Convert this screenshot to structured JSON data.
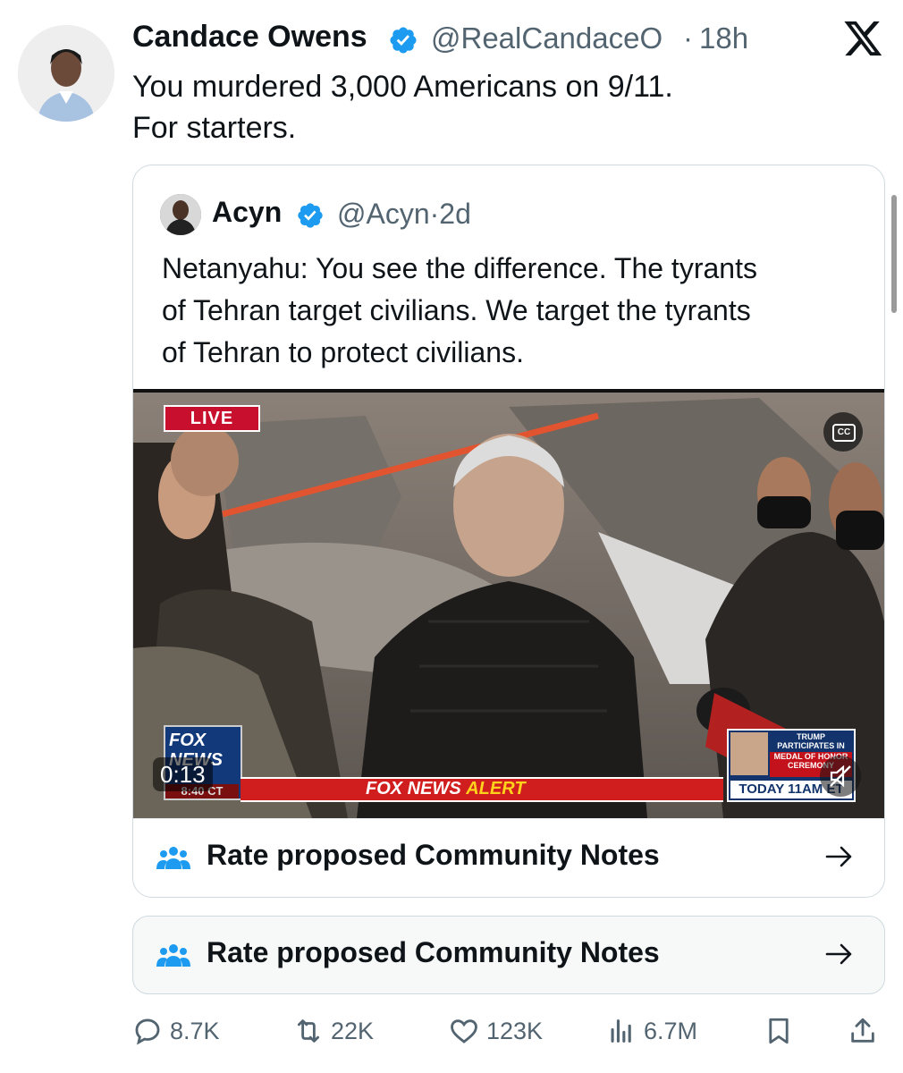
{
  "tweet": {
    "author_name": "Candace Owens",
    "author_handle": "@RealCandaceO",
    "separator": "·",
    "time_ago": "18h",
    "text_lines": [
      "You murdered 3,000 Americans on 9/11.",
      "For starters."
    ]
  },
  "quoted": {
    "author_name": "Acyn",
    "author_handle": "@Acyn",
    "separator": "·",
    "time_ago": "2d",
    "text_lines": [
      "Netanyahu: You see the difference. The tyrants",
      "of Tehran target civilians. We target the tyrants",
      "of Tehran to protect civilians."
    ],
    "video": {
      "live_badge": "LIVE",
      "cc_label": "CC",
      "timer": "0:13",
      "network_logo_top": "FOX",
      "network_logo_bottom": "NEWS",
      "network_clock": "8:40 CT",
      "alert_prefix": "FOX NEWS",
      "alert_word": "ALERT",
      "promo_top": "TRUMP PARTICIPATES IN",
      "promo_mid": "MEDAL OF HONOR CEREMONY",
      "promo_bottom": "TODAY 11AM ET"
    }
  },
  "community_notes": {
    "label_1": "Rate proposed Community Notes",
    "label_2": "Rate proposed Community Notes"
  },
  "actions": {
    "replies": "8.7K",
    "reposts": "22K",
    "likes": "123K",
    "views": "6.7M"
  },
  "colors": {
    "verified_blue": "#1d9bf0",
    "secondary_text": "#536471",
    "notes_icon": "#1d9bf0",
    "fox_red": "#d01d1d"
  },
  "icons": [
    "verified-badge-icon",
    "x-logo-icon",
    "people-icon",
    "arrow-right-icon",
    "reply-icon",
    "repost-icon",
    "like-icon",
    "views-icon",
    "bookmark-icon",
    "share-icon",
    "cc-icon",
    "mute-icon"
  ]
}
